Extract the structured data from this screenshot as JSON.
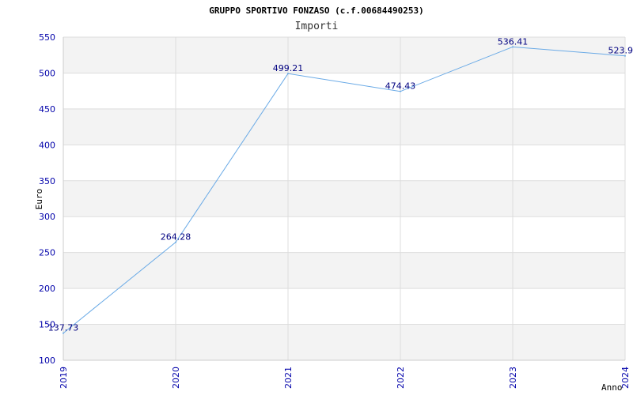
{
  "chart_data": {
    "type": "line",
    "title": "GRUPPO SPORTIVO FONZASO (c.f.00684490253)",
    "subtitle": "Importi",
    "xlabel": "Anno",
    "ylabel": "Euro",
    "categories": [
      "2019",
      "2020",
      "2021",
      "2022",
      "2023",
      "2024"
    ],
    "values": [
      137.73,
      264.28,
      499.21,
      474.43,
      536.41,
      523.9
    ],
    "data_labels": [
      "137.73",
      "264.28",
      "499.21",
      "474.43",
      "536.41",
      "523.9"
    ],
    "ylim": [
      100,
      550
    ],
    "yticks": [
      100,
      150,
      200,
      250,
      300,
      350,
      400,
      450,
      500,
      550
    ],
    "grid": true,
    "colors": {
      "line": "#6aaae6",
      "band": "#f3f3f3",
      "grid": "#dddddd",
      "tick_text": "#0000aa",
      "label_text": "#000080"
    }
  }
}
